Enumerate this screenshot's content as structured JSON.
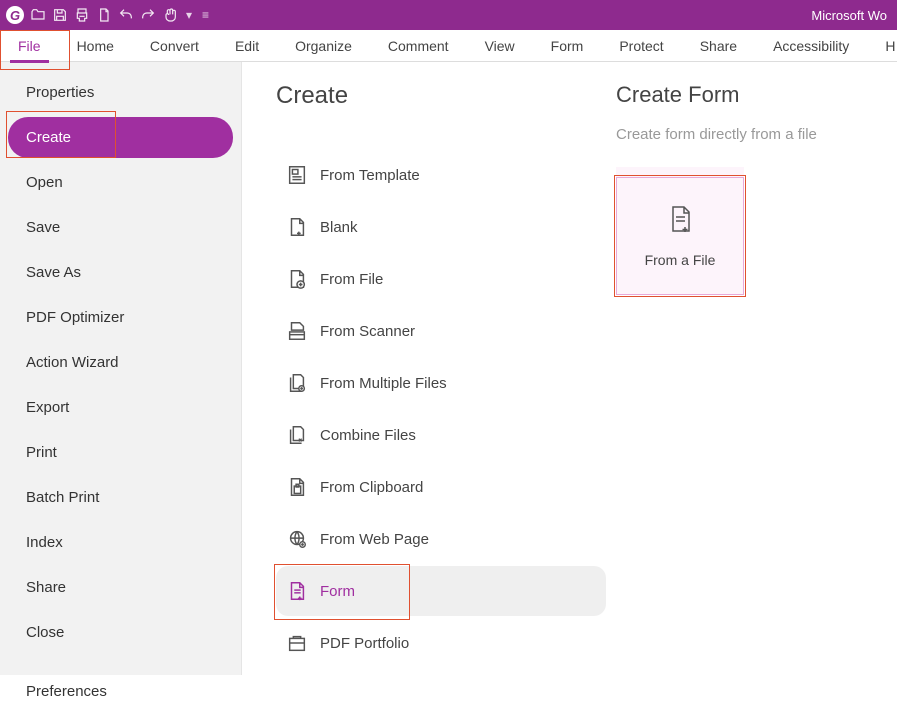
{
  "titlebar": {
    "app_name": "Microsoft Wo"
  },
  "ribbon": {
    "tabs": [
      "File",
      "Home",
      "Convert",
      "Edit",
      "Organize",
      "Comment",
      "View",
      "Form",
      "Protect",
      "Share",
      "Accessibility",
      "H"
    ]
  },
  "sidebar": {
    "items": [
      {
        "label": "Properties"
      },
      {
        "label": "Create"
      },
      {
        "label": "Open"
      },
      {
        "label": "Save"
      },
      {
        "label": "Save As"
      },
      {
        "label": "PDF Optimizer"
      },
      {
        "label": "Action Wizard"
      },
      {
        "label": "Export"
      },
      {
        "label": "Print"
      },
      {
        "label": "Batch Print"
      },
      {
        "label": "Index"
      },
      {
        "label": "Share"
      },
      {
        "label": "Close"
      },
      {
        "label": "Preferences"
      }
    ]
  },
  "create": {
    "title": "Create",
    "items": [
      {
        "label": "From Template"
      },
      {
        "label": "Blank"
      },
      {
        "label": "From File"
      },
      {
        "label": "From Scanner"
      },
      {
        "label": "From Multiple Files"
      },
      {
        "label": "Combine Files"
      },
      {
        "label": "From Clipboard"
      },
      {
        "label": "From Web Page"
      },
      {
        "label": "Form"
      },
      {
        "label": "PDF Portfolio"
      }
    ]
  },
  "form_panel": {
    "title": "Create Form",
    "subtitle": "Create form directly from a file",
    "tile_label": "From a File"
  }
}
